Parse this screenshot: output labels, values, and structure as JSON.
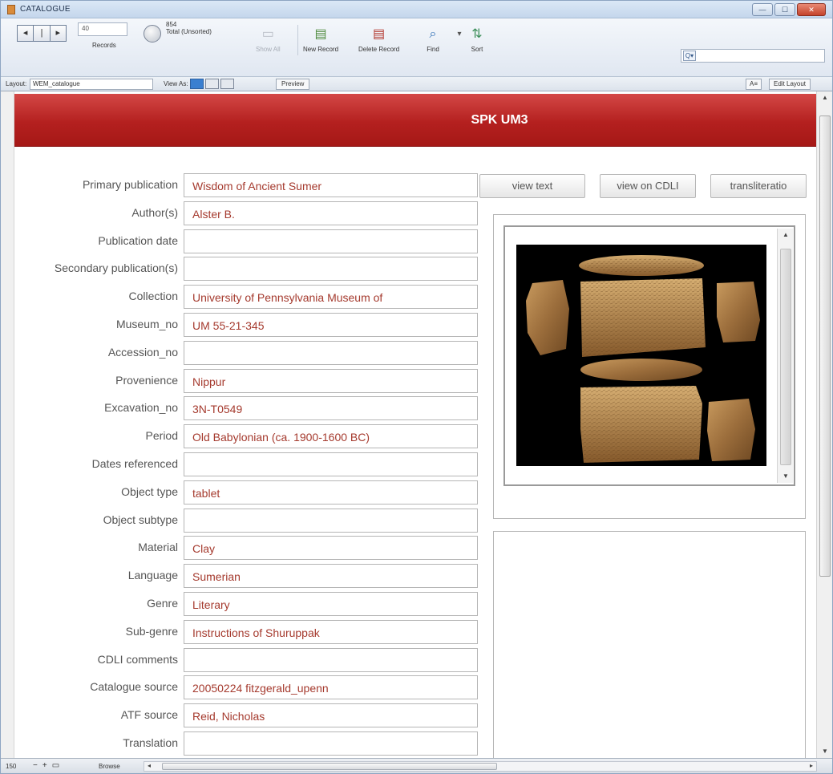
{
  "window": {
    "title": "CATALOGUE",
    "buttons": [
      "—",
      "☐",
      "✕"
    ]
  },
  "toolbar": {
    "record_value": "40",
    "records_label": "Records",
    "found_count": "854",
    "found_label": "Total (Unsorted)",
    "show_all": "Show All",
    "new_record": "New Record",
    "delete_record": "Delete Record",
    "find": "Find",
    "sort": "Sort",
    "search_icon_text": "Q▾"
  },
  "layoutbar": {
    "layout_label": "Layout:",
    "layout_value": "WEM_catalogue",
    "view_as_label": "View As:",
    "preview": "Preview",
    "aa": "A≡",
    "edit_layout": "Edit Layout"
  },
  "record": {
    "header_title": "SPK UM3",
    "fields": [
      {
        "label": "Primary publication",
        "value": "Wisdom of Ancient Sumer"
      },
      {
        "label": "Author(s)",
        "value": "Alster B."
      },
      {
        "label": "Publication date",
        "value": ""
      },
      {
        "label": "Secondary publication(s)",
        "value": ""
      },
      {
        "label": "Collection",
        "value": "University of Pennsylvania Museum of"
      },
      {
        "label": "Museum_no",
        "value": "UM 55-21-345"
      },
      {
        "label": "Accession_no",
        "value": ""
      },
      {
        "label": "Provenience",
        "value": "Nippur"
      },
      {
        "label": "Excavation_no",
        "value": "3N-T0549"
      },
      {
        "label": "Period",
        "value": "Old Babylonian (ca. 1900-1600 BC)"
      },
      {
        "label": "Dates referenced",
        "value": ""
      },
      {
        "label": "Object type",
        "value": "tablet"
      },
      {
        "label": "Object subtype",
        "value": ""
      },
      {
        "label": "Material",
        "value": "Clay"
      },
      {
        "label": "Language",
        "value": "Sumerian"
      },
      {
        "label": "Genre",
        "value": "Literary"
      },
      {
        "label": "Sub-genre",
        "value": "Instructions of Shuruppak"
      },
      {
        "label": "CDLI comments",
        "value": ""
      },
      {
        "label": "Catalogue source",
        "value": "20050224 fitzgerald_upenn"
      },
      {
        "label": "ATF source",
        "value": "Reid, Nicholas"
      },
      {
        "label": "Translation",
        "value": ""
      }
    ],
    "buttons": {
      "view_text": "view text",
      "view_on_cdli": "view on CDLI",
      "transliteration": "transliteratio"
    }
  },
  "statusbar": {
    "zoom": "150",
    "mode": "Browse"
  },
  "colors": {
    "header_red": "#b4201f",
    "value_text": "#a53a2e",
    "label_text": "#555555"
  }
}
